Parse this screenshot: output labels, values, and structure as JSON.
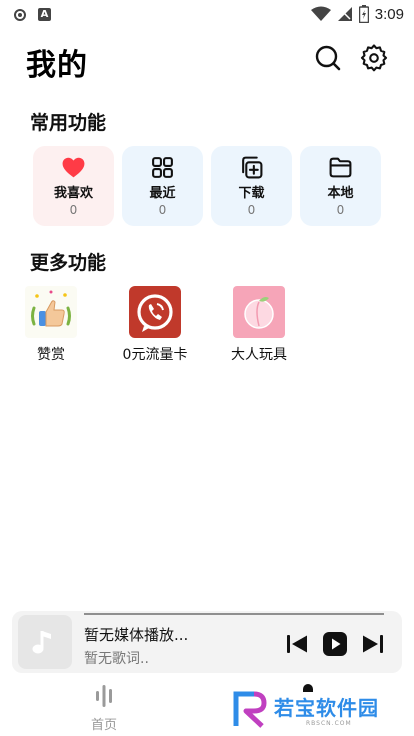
{
  "status_bar": {
    "time": "3:09",
    "icons": [
      "record-icon",
      "a-icon",
      "wifi-icon",
      "signal-icon",
      "battery-icon"
    ]
  },
  "header": {
    "title": "我的",
    "icons": [
      "search-icon",
      "gear-icon"
    ]
  },
  "common_functions": {
    "title": "常用功能",
    "items": [
      {
        "label": "我喜欢",
        "count": "0",
        "icon": "heart-icon"
      },
      {
        "label": "最近",
        "count": "0",
        "icon": "grid-icon"
      },
      {
        "label": "下载",
        "count": "0",
        "icon": "download-copy-icon"
      },
      {
        "label": "本地",
        "count": "0",
        "icon": "folder-icon"
      }
    ]
  },
  "more_functions": {
    "title": "更多功能",
    "items": [
      {
        "label": "赞赏",
        "icon": "thumbs-up-icon"
      },
      {
        "label": "0元流量卡",
        "icon": "phone-icon"
      },
      {
        "label": "大人玩具",
        "icon": "peach-icon"
      }
    ]
  },
  "player": {
    "title": "暂无媒体播放...",
    "lyric": "暂无歌词..",
    "controls": [
      "previous-icon",
      "play-icon",
      "next-icon"
    ]
  },
  "tab_bar": {
    "home_label": "首页"
  },
  "watermark": {
    "text": "若宝软件园",
    "subtext": "RBSCN.COM"
  },
  "colors": {
    "heart": "#ff3b46",
    "card_blue": "#ecf5fd",
    "card_pink": "#fdf0f0",
    "phone_red": "#c0392b",
    "peach_pink": "#f6a5b8"
  }
}
